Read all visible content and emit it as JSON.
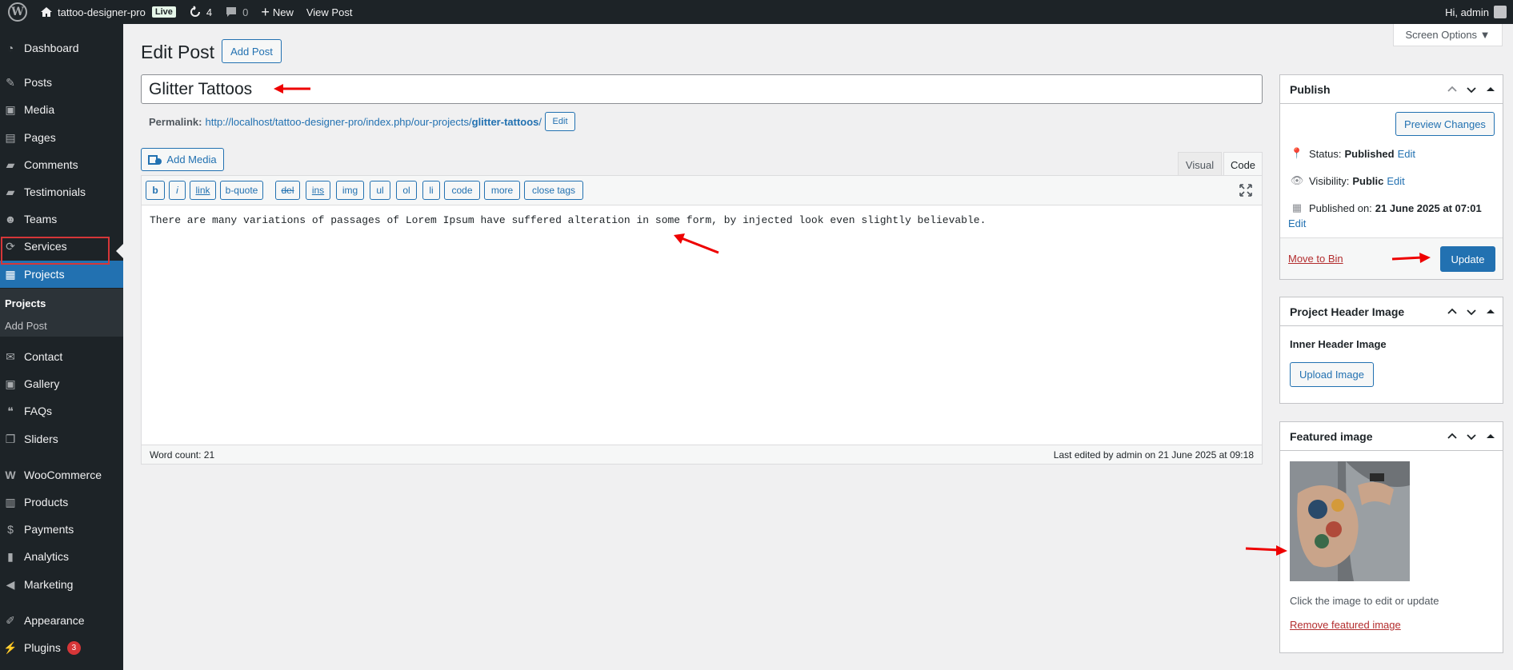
{
  "admin_bar": {
    "site_name": "tattoo-designer-pro",
    "live_badge": "Live",
    "updates_count": "4",
    "comments_count": "0",
    "new_label": "New",
    "view_post_label": "View Post",
    "greeting": "Hi, admin"
  },
  "sidebar": {
    "items": [
      {
        "label": "Dashboard",
        "icon": "dashboard-icon"
      },
      {
        "label": "Posts",
        "icon": "pin-icon"
      },
      {
        "label": "Media",
        "icon": "media-icon"
      },
      {
        "label": "Pages",
        "icon": "pages-icon"
      },
      {
        "label": "Comments",
        "icon": "comment-icon"
      },
      {
        "label": "Testimonials",
        "icon": "testimonial-icon"
      },
      {
        "label": "Teams",
        "icon": "teams-icon"
      },
      {
        "label": "Services",
        "icon": "services-icon"
      },
      {
        "label": "Projects",
        "icon": "portfolio-icon"
      },
      {
        "label": "Contact",
        "icon": "mail-icon"
      },
      {
        "label": "Gallery",
        "icon": "gallery-icon"
      },
      {
        "label": "FAQs",
        "icon": "faq-icon"
      },
      {
        "label": "Sliders",
        "icon": "slides-icon"
      },
      {
        "label": "WooCommerce",
        "icon": "woo-icon"
      },
      {
        "label": "Products",
        "icon": "archive-icon"
      },
      {
        "label": "Payments",
        "icon": "payments-icon"
      },
      {
        "label": "Analytics",
        "icon": "chart-bar-icon"
      },
      {
        "label": "Marketing",
        "icon": "megaphone-icon"
      },
      {
        "label": "Appearance",
        "icon": "brush-icon"
      },
      {
        "label": "Plugins",
        "icon": "plugin-icon"
      }
    ],
    "submenu": {
      "current": "Projects",
      "add": "Add Post"
    },
    "plugins_badge": "3"
  },
  "header": {
    "page_title": "Edit Post",
    "add_post_label": "Add Post",
    "screen_options_label": "Screen Options ▼"
  },
  "post": {
    "title": "Glitter Tattoos",
    "permalink_label": "Permalink:",
    "permalink_base": "http://localhost/tattoo-designer-pro/index.php/our-projects/",
    "permalink_slug": "glitter-tattoos",
    "permalink_trail": "/",
    "permalink_edit": "Edit"
  },
  "editor": {
    "add_media_label": "Add Media",
    "tab_visual": "Visual",
    "tab_code": "Code",
    "quicktags": [
      "b",
      "i",
      "link",
      "b-quote",
      "del",
      "ins",
      "img",
      "ul",
      "ol",
      "li",
      "code",
      "more",
      "close tags"
    ],
    "content": "There are many variations of passages of Lorem Ipsum have suffered alteration in some form, by injected look even slightly believable.",
    "word_count": "Word count: 21",
    "last_edited": "Last edited by admin on 21 June 2025 at 09:18"
  },
  "publish_box": {
    "title": "Publish",
    "preview_label": "Preview Changes",
    "status_label": "Status:",
    "status_value": "Published",
    "visibility_label": "Visibility:",
    "visibility_value": "Public",
    "published_label": "Published on:",
    "published_value": "21 June 2025 at 07:01",
    "edit_label": "Edit",
    "move_to_bin": "Move to Bin",
    "update_label": "Update"
  },
  "header_image_box": {
    "title": "Project Header Image",
    "field_label": "Inner Header Image",
    "upload_label": "Upload Image"
  },
  "featured_box": {
    "title": "Featured image",
    "hint": "Click the image to edit or update",
    "remove_label": "Remove featured image"
  },
  "colors": {
    "admin_dark": "#1d2327",
    "accent": "#2271b1",
    "danger": "#d63638"
  }
}
